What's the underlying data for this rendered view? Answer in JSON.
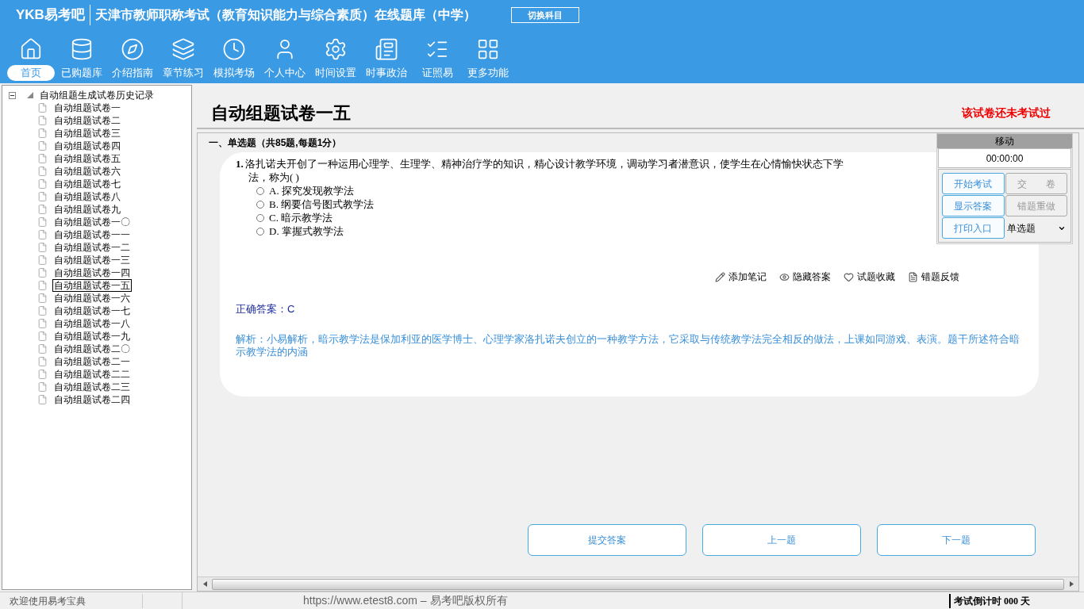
{
  "header": {
    "logo": "YKB易考吧",
    "title": "天津市教师职称考试（教育知识能力与综合素质）在线题库（中学）",
    "switch_button": "切换科目"
  },
  "nav": [
    {
      "label": "首页",
      "selected": true
    },
    {
      "label": "已购题库",
      "selected": false
    },
    {
      "label": "介绍指南",
      "selected": false
    },
    {
      "label": "章节练习",
      "selected": false
    },
    {
      "label": "模拟考场",
      "selected": false
    },
    {
      "label": "个人中心",
      "selected": false
    },
    {
      "label": "时间设置",
      "selected": false
    },
    {
      "label": "时事政治",
      "selected": false
    },
    {
      "label": "证照易",
      "selected": false
    },
    {
      "label": "更多功能",
      "selected": false
    }
  ],
  "tree": {
    "label": "自动组题生成试卷历史记录",
    "expanded": true,
    "children": [
      {
        "label": "自动组题试卷一",
        "selected": false
      },
      {
        "label": "自动组题试卷二",
        "selected": false
      },
      {
        "label": "自动组题试卷三",
        "selected": false
      },
      {
        "label": "自动组题试卷四",
        "selected": false
      },
      {
        "label": "自动组题试卷五",
        "selected": false
      },
      {
        "label": "自动组题试卷六",
        "selected": false
      },
      {
        "label": "自动组题试卷七",
        "selected": false
      },
      {
        "label": "自动组题试卷八",
        "selected": false
      },
      {
        "label": "自动组题试卷九",
        "selected": false
      },
      {
        "label": "自动组题试卷一〇",
        "selected": false
      },
      {
        "label": "自动组题试卷一一",
        "selected": false
      },
      {
        "label": "自动组题试卷一二",
        "selected": false
      },
      {
        "label": "自动组题试卷一三",
        "selected": false
      },
      {
        "label": "自动组题试卷一四",
        "selected": false
      },
      {
        "label": "自动组题试卷一五",
        "selected": true
      },
      {
        "label": "自动组题试卷一六",
        "selected": false
      },
      {
        "label": "自动组题试卷一七",
        "selected": false
      },
      {
        "label": "自动组题试卷一八",
        "selected": false
      },
      {
        "label": "自动组题试卷一九",
        "selected": false
      },
      {
        "label": "自动组题试卷二〇",
        "selected": false
      },
      {
        "label": "自动组题试卷二一",
        "selected": false
      },
      {
        "label": "自动组题试卷二二",
        "selected": false
      },
      {
        "label": "自动组题试卷二三",
        "selected": false
      },
      {
        "label": "自动组题试卷二四",
        "selected": false
      }
    ]
  },
  "paper": {
    "title": "自动组题试卷一五",
    "status": "该试卷还未考试过",
    "section": "一、单选题（共85题,每题1分）",
    "question": {
      "number": "1.",
      "text_line_1": "洛扎诺夫开创了一种运用心理学、生理学、精神治疗学的知识，精心设计教学环境，调动学习者潜意识，使学生在心情愉快状态下学",
      "text_line_2": "法，称为( )",
      "options": [
        {
          "label": "A. 探究发现教学法",
          "selected": false
        },
        {
          "label": "B. 纲要信号图式教学法",
          "selected": false
        },
        {
          "label": "C. 暗示教学法",
          "selected": false
        },
        {
          "label": "D. 掌握式教学法",
          "selected": false
        }
      ],
      "actions": [
        "添加笔记",
        "隐藏答案",
        "试题收藏",
        "错题反馈"
      ],
      "answer": "正确答案：C",
      "analysis": "解析：小易解析，暗示教学法是保加利亚的医学博士、心理学家洛扎诺夫创立的一种教学方法，它采取与传统教学法完全相反的做法，上课如同游戏、表演。题干所述符合暗示教学法的内涵"
    },
    "buttons": [
      "提交答案",
      "上一题",
      "下一题"
    ]
  },
  "panel": {
    "title": "移动",
    "timer": "00:00:00",
    "buttons": [
      {
        "label": "开始考试",
        "disabled": false
      },
      {
        "label": "交　　卷",
        "disabled": true
      },
      {
        "label": "显示答案",
        "disabled": false
      },
      {
        "label": "错题重做",
        "disabled": true
      },
      {
        "label": "打印入口",
        "disabled": false
      }
    ],
    "select": "单选题"
  },
  "status_bar": {
    "welcome": "欢迎使用易考宝典",
    "copyright": "https://www.etest8.com – 易考吧版权所有",
    "countdown": "考试倒计时 000 天"
  }
}
